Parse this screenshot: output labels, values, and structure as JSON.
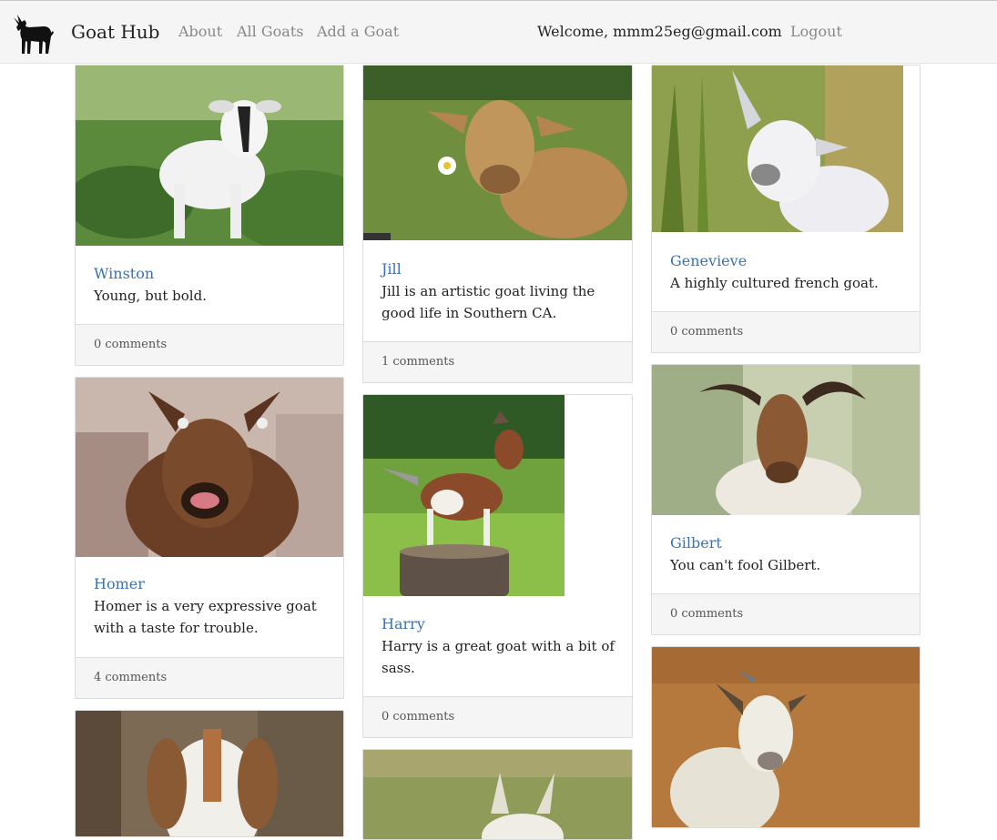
{
  "app": {
    "brand": "Goat Hub",
    "nav": {
      "about": "About",
      "all_goats": "All Goats",
      "add_goat": "Add a Goat",
      "logout": "Logout"
    },
    "welcome": "Welcome, mmm25eg@gmail.com"
  },
  "colors": {
    "accent": "#3a72b8",
    "navbar_bg": "#f5f5f5",
    "footer_bg": "#f5f5f5"
  },
  "goats": [
    {
      "name": "Winston",
      "description": "Young, but bold.",
      "comments": "0 comments"
    },
    {
      "name": "Homer",
      "description": "Homer is a very expressive goat with a taste for trouble.",
      "comments": "4 comments"
    },
    {
      "name": "Jill",
      "description": "Jill is an artistic goat living the good life in Southern CA.",
      "comments": "1 comments"
    },
    {
      "name": "Harry",
      "description": "Harry is a great goat with a bit of sass.",
      "comments": "0 comments"
    },
    {
      "name": "Genevieve",
      "description": "A highly cultured french goat.",
      "comments": "0 comments"
    },
    {
      "name": "Gilbert",
      "description": "You can't fool Gilbert.",
      "comments": "0 comments"
    }
  ]
}
